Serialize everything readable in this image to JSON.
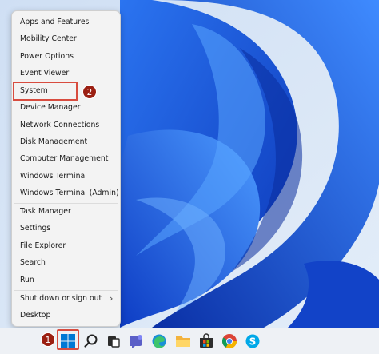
{
  "context_menu": {
    "items": [
      "Apps and Features",
      "Mobility Center",
      "Power Options",
      "Event Viewer",
      "System",
      "Device Manager",
      "Network Connections",
      "Disk Management",
      "Computer Management",
      "Windows Terminal",
      "Windows Terminal (Admin)",
      "Task Manager",
      "Settings",
      "File Explorer",
      "Search",
      "Run",
      "Shut down or sign out",
      "Desktop"
    ],
    "shutdown_arrow": "›"
  },
  "annotations": {
    "step1": "1",
    "step2": "2",
    "highlight_color": "#d84c3f",
    "badge_color": "#9b1f12"
  },
  "taskbar": {
    "icons": [
      "windows-start-icon",
      "search-icon",
      "task-view-icon",
      "chat-icon",
      "edge-icon",
      "file-explorer-icon",
      "store-icon",
      "chrome-icon",
      "skype-icon"
    ]
  },
  "colors": {
    "wallpaper_blue": "#1f5fe0",
    "wallpaper_bg": "#dfe9f6",
    "accent": "#0067c0"
  }
}
